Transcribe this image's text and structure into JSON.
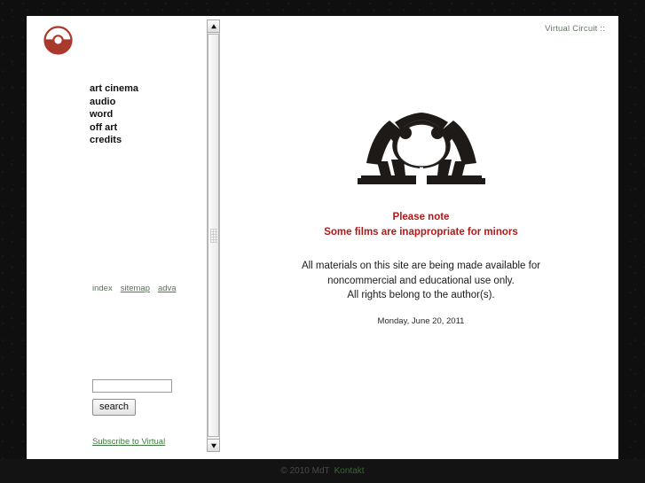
{
  "site": {
    "label": "Virtual Circuit ::",
    "accent_red": "#b11919",
    "logo_red": "#a8392c",
    "link_green": "#4f7a4f",
    "page_bg": "#ffffff",
    "desktop_bg": "#0f0f0f"
  },
  "sidebar": {
    "logo_name": "virtual-circuit-logo",
    "nav": [
      {
        "label": "art cinema"
      },
      {
        "label": "audio"
      },
      {
        "label": "word"
      },
      {
        "label": "off art"
      },
      {
        "label": "credits"
      }
    ],
    "util_links": [
      {
        "label": "index"
      },
      {
        "label": "sitemap"
      },
      {
        "label": "adva"
      }
    ],
    "search": {
      "value": "",
      "placeholder": "",
      "button_label": "search"
    },
    "subscribe_label": "Subscribe to Virtual"
  },
  "main": {
    "artwork_name": "mirrored-figures-silhouette",
    "notice": {
      "line1": "Please note",
      "line2": "Some films are inappropriate for minors"
    },
    "legal": {
      "line1": "All materials on this site are being made available for",
      "line2": "noncommercial and educational use only.",
      "line3": "All rights belong to the author(s)."
    },
    "date": "Monday, June 20, 2011"
  },
  "footer": {
    "copyright": "© 2010 MdT",
    "contact_label": "Kontakt"
  },
  "scrollbars": {
    "vertical_position_percent": 0,
    "horizontal_position_percent": 18
  }
}
